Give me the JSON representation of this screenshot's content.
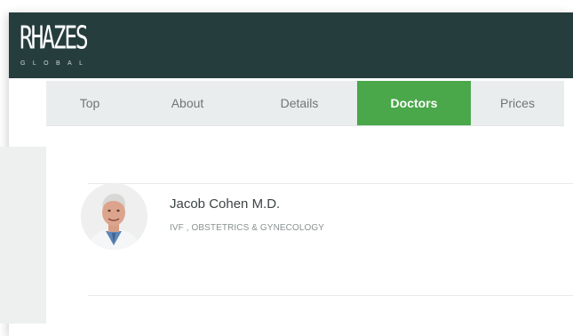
{
  "brand": {
    "logo_text": "RHAZES",
    "logo_sub": "GLOBAL"
  },
  "nav": {
    "tabs": [
      {
        "label": "Top",
        "active": false
      },
      {
        "label": "About",
        "active": false
      },
      {
        "label": "Details",
        "active": false
      },
      {
        "label": "Doctors",
        "active": true
      },
      {
        "label": "Prices",
        "active": false
      }
    ],
    "active_color": "#4aa74a"
  },
  "doctor": {
    "name": "Jacob Cohen M.D.",
    "specialty": "IVF , OBSTETRICS & GYNECOLOGY",
    "avatar_icon": "doctor-portrait"
  },
  "colors": {
    "header_bg": "#263d3d",
    "tab_text": "#6e7676"
  }
}
